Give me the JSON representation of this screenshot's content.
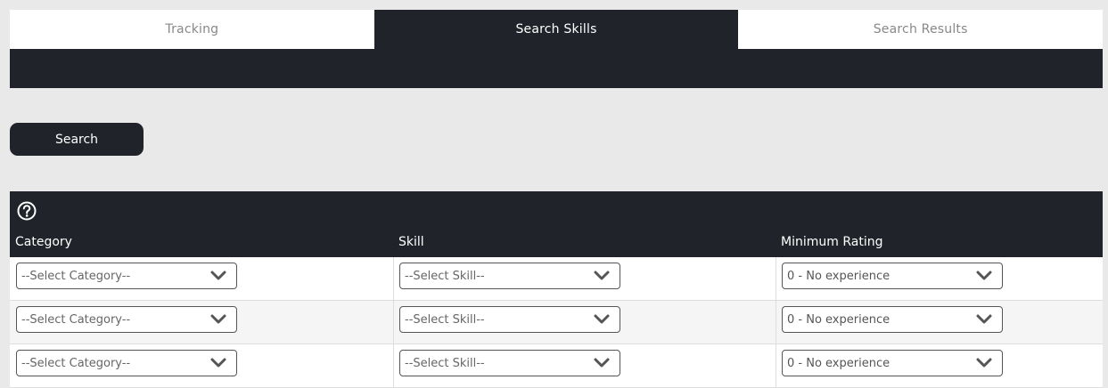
{
  "tabs": [
    {
      "label": "Tracking"
    },
    {
      "label": "Search Skills"
    },
    {
      "label": "Search Results"
    }
  ],
  "search_button": {
    "label": "Search"
  },
  "table": {
    "headers": {
      "category": "Category",
      "skill": "Skill",
      "min_rating": "Minimum Rating"
    },
    "rows": [
      {
        "category": "--Select Category--",
        "skill": "--Select Skill--",
        "min_rating": "0 - No experience"
      },
      {
        "category": "--Select Category--",
        "skill": "--Select Skill--",
        "min_rating": "0 - No experience"
      },
      {
        "category": "--Select Category--",
        "skill": "--Select Skill--",
        "min_rating": "0 - No experience"
      }
    ]
  },
  "icons": {
    "help": "help-icon",
    "dropdown": "chevron-down-icon"
  },
  "colors": {
    "dark": "#202329",
    "background": "#e9e9e9"
  }
}
